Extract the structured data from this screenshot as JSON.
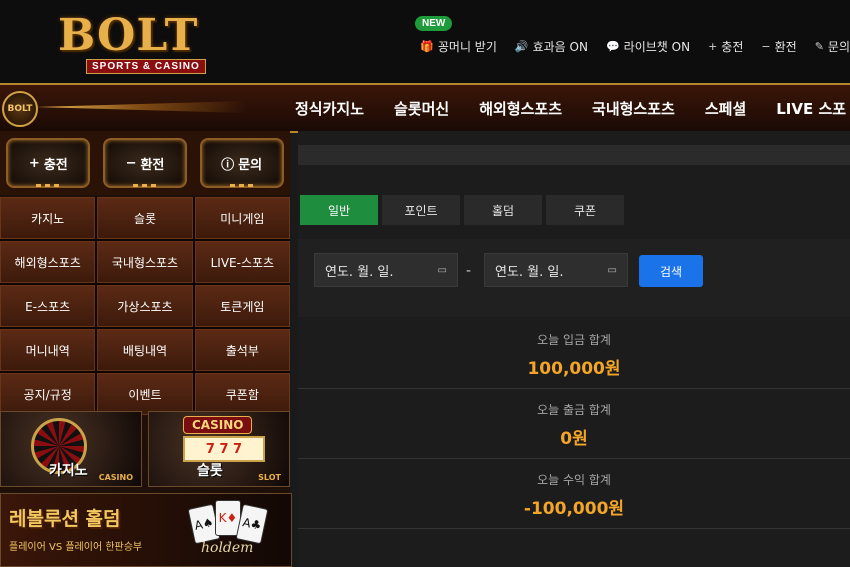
{
  "header": {
    "logo_text": "BOLT",
    "logo_sub": "SPORTS & CASINO",
    "new_badge": "NEW",
    "util": [
      {
        "icon": "gift-icon",
        "glyph": "🎁",
        "label": "꽁머니 받기"
      },
      {
        "icon": "speaker-icon",
        "glyph": "🔊",
        "label": "효과음 ON"
      },
      {
        "icon": "chat-icon",
        "glyph": "💬",
        "label": "라이브챗 ON"
      },
      {
        "icon": "plus-icon",
        "glyph": "+",
        "label": "충전"
      },
      {
        "icon": "minus-icon",
        "glyph": "−",
        "label": "환전"
      },
      {
        "icon": "edit-icon",
        "glyph": "✎",
        "label": "문의"
      }
    ]
  },
  "nav": {
    "logo_text": "BOLT",
    "items": [
      "정식카지노",
      "슬롯머신",
      "해외형스포츠",
      "국내형스포츠",
      "스페셜",
      "LIVE 스포"
    ]
  },
  "sidebar": {
    "top_buttons": [
      {
        "glyph": "+",
        "label": "충전"
      },
      {
        "glyph": "−",
        "label": "환전"
      },
      {
        "glyph": "ⓘ",
        "label": "문의"
      }
    ],
    "menu": [
      "카지노",
      "슬롯",
      "미니게임",
      "해외형스포츠",
      "국내형스포츠",
      "LIVE-스포츠",
      "E-스포츠",
      "가상스포츠",
      "토큰게임",
      "머니내역",
      "배팅내역",
      "출석부",
      "공지/규정",
      "이벤트",
      "쿠폰함"
    ],
    "banners": [
      {
        "title": "카지노",
        "sub": "CASINO"
      },
      {
        "title": "슬롯",
        "sub": "SLOT",
        "sign": "CASINO",
        "reels": "7 7 7"
      }
    ],
    "holdem": {
      "title": "레볼루션 홀덤",
      "sub": "플레이어 VS 플레이어 한판승부",
      "logo": "holdem",
      "cards": [
        "A♠",
        "K♦",
        "A♣"
      ]
    }
  },
  "main": {
    "tabs": [
      "일반",
      "포인트",
      "홀덤",
      "쿠폰"
    ],
    "active_tab": "일반",
    "date_from": "연도. 월. 일.",
    "date_to": "연도. 월. 일.",
    "search_label": "검색",
    "stats": [
      {
        "label": "오늘 입금 합계",
        "value": "100,000원"
      },
      {
        "label": "오늘 출금 합계",
        "value": "0원"
      },
      {
        "label": "오늘 수익 합계",
        "value": "-100,000원"
      }
    ]
  },
  "colors": {
    "accent_gold": "#e8b04a",
    "active_tab": "#1e8e3e",
    "search_blue": "#1a73e8",
    "stat_value": "#f3a527"
  }
}
